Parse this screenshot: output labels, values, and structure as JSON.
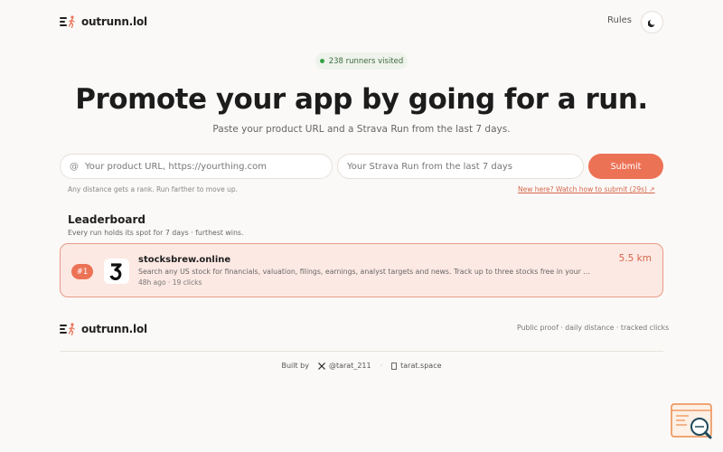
{
  "brand": {
    "name": "outrunn.lol"
  },
  "header": {
    "rules_label": "Rules"
  },
  "badge": {
    "text": "238 runners visited"
  },
  "hero": {
    "title": "Promote your app by going for a run.",
    "subtitle": "Paste your product URL and a Strava Run from the last 7 days."
  },
  "form": {
    "url_placeholder": "Your product URL, https://yourthing.com",
    "url_prefix": "@",
    "strava_placeholder": "Your Strava Run from the last 7 days",
    "submit_label": "Submit",
    "hint": "Any distance gets a rank. Run farther to move up.",
    "help_link": "New here? Watch how to submit (29s) ↗"
  },
  "leaderboard": {
    "title": "Leaderboard",
    "subtitle": "Every run holds its spot for 7 days · furthest wins.",
    "entries": [
      {
        "rank": "#1",
        "name": "stocksbrew.online",
        "description": "Search any US stock for financials, valuation, filings, earnings, analyst targets and news. Track up to three stocks free in your …",
        "meta": "48h ago · 19 clicks",
        "distance": "5.5 km"
      }
    ]
  },
  "footer": {
    "tagline": "Public proof · daily distance · tracked clicks",
    "built_by_label": "Built by",
    "x_handle": "@tarat_211",
    "site": "tarat.space"
  },
  "colors": {
    "accent": "#ec7256",
    "card_bg": "#fde9e3",
    "card_border": "#e89a86",
    "badge_dot": "#3aa14a"
  }
}
